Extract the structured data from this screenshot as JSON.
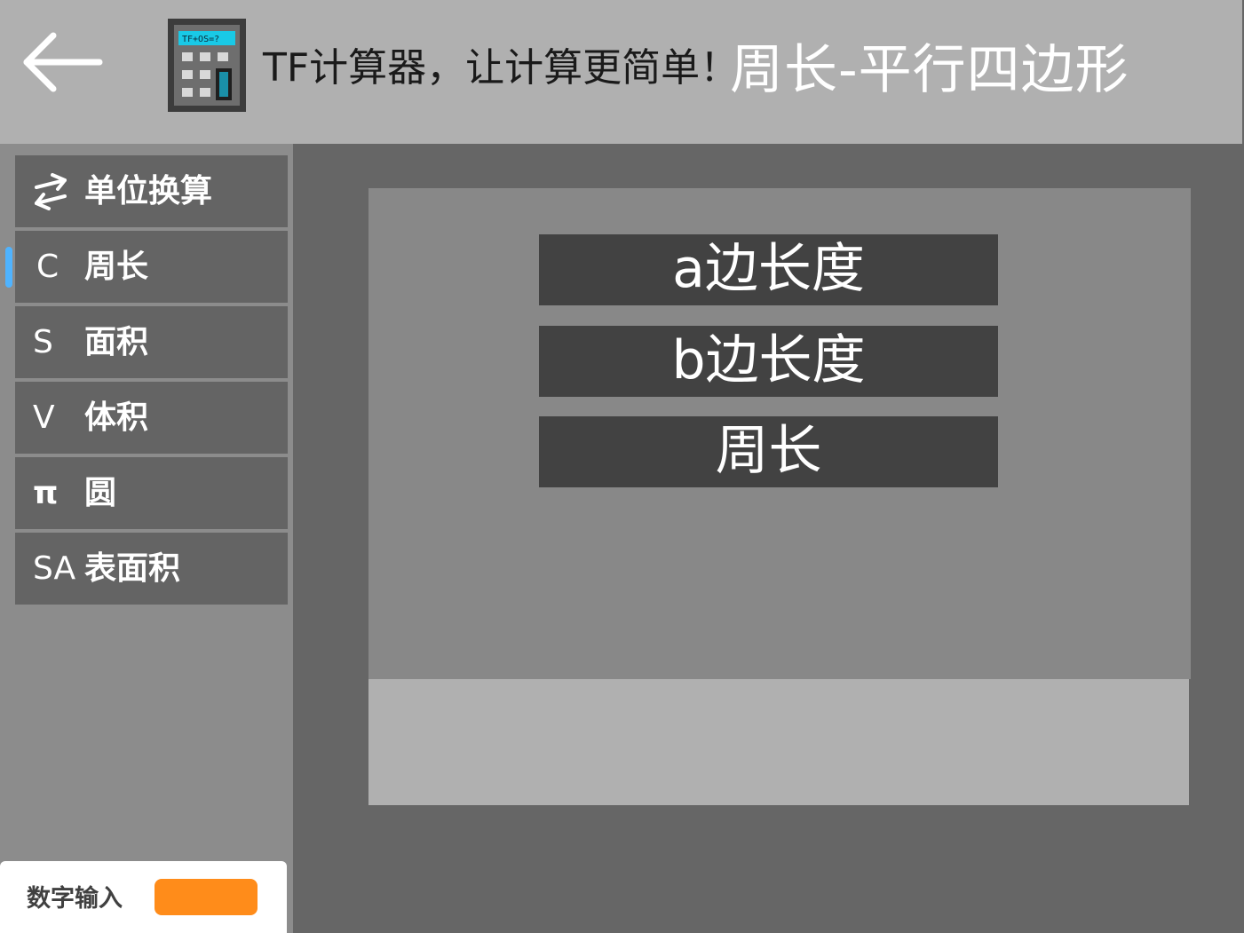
{
  "header": {
    "app_title": "TF计算器，让计算更简单！",
    "page_title": "周长-平行四边形",
    "icon_screen_text": "TF+OS=?"
  },
  "sidebar": {
    "items": [
      {
        "icon": "⇄",
        "label": "单位换算",
        "icon_name": "convert-arrows-icon"
      },
      {
        "icon": "C",
        "label": "周长",
        "icon_name": "circumference-c-icon",
        "active": true
      },
      {
        "icon": "S",
        "label": "面积",
        "icon_name": "area-s-icon"
      },
      {
        "icon": "V",
        "label": "体积",
        "icon_name": "volume-v-icon"
      },
      {
        "icon": "π",
        "label": "圆",
        "icon_name": "pi-icon"
      },
      {
        "icon": "SA",
        "label": "表面积",
        "icon_name": "surface-area-sa-icon"
      }
    ]
  },
  "numpad": {
    "label": "数字输入",
    "toggle_color": "#ff8c1a"
  },
  "form": {
    "fields": [
      {
        "label": "a边长度"
      },
      {
        "label": "b边长度"
      },
      {
        "label": "周长"
      }
    ]
  },
  "colors": {
    "header_bg": "#b0b0b0",
    "content_bg": "#666666",
    "sidebar_bg": "#8c8c8c",
    "nav_item_bg": "#646464",
    "active_indicator": "#4fb3ff",
    "panel_bg": "#888888",
    "field_bg": "#424242",
    "result_bg": "#b0b0b0"
  }
}
